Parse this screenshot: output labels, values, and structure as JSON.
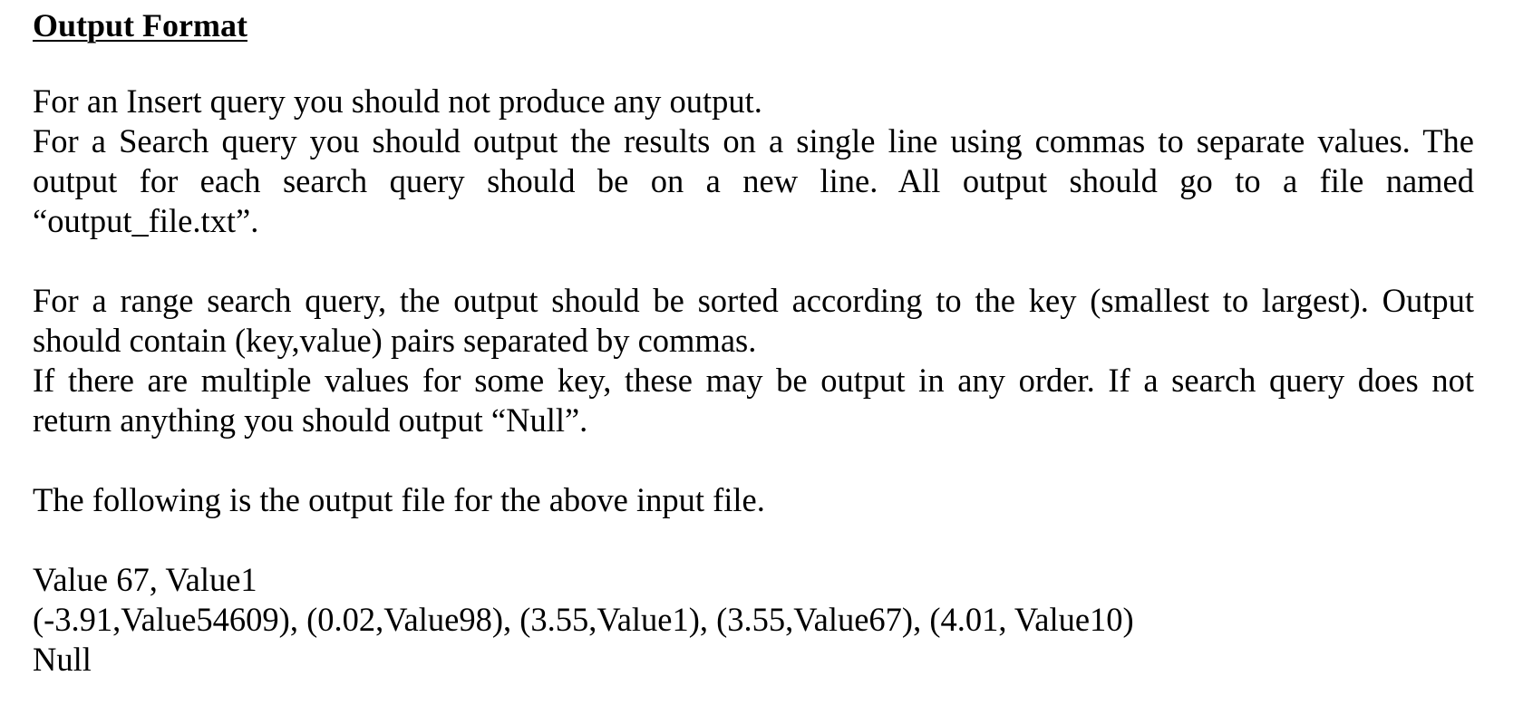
{
  "document": {
    "heading": "Output Format",
    "para1": {
      "line1": "For an Insert query you should not produce any output.",
      "line2": "For a Search query you should output the results on a single line using commas to separate values. The",
      "line3": "output for each search query should be on a new line. All output should go to a file named",
      "line4": "“output_file.txt”."
    },
    "para2": {
      "line1": "For a range search query, the output should be sorted according to the key (smallest to largest). Output",
      "line2": "should contain (key,value) pairs separated by commas.",
      "line3": "If there are multiple values for some key, these may be output in any order. If a search query does not",
      "line4": "return anything you should output “Null”."
    },
    "para3": {
      "line1": "The following is the output file for the above input file."
    },
    "output_example": {
      "line1": "Value 67, Value1",
      "line2": "(-3.91,Value54609), (0.02,Value98), (3.55,Value1), (3.55,Value67), (4.01, Value10)",
      "line3": "Null"
    }
  }
}
